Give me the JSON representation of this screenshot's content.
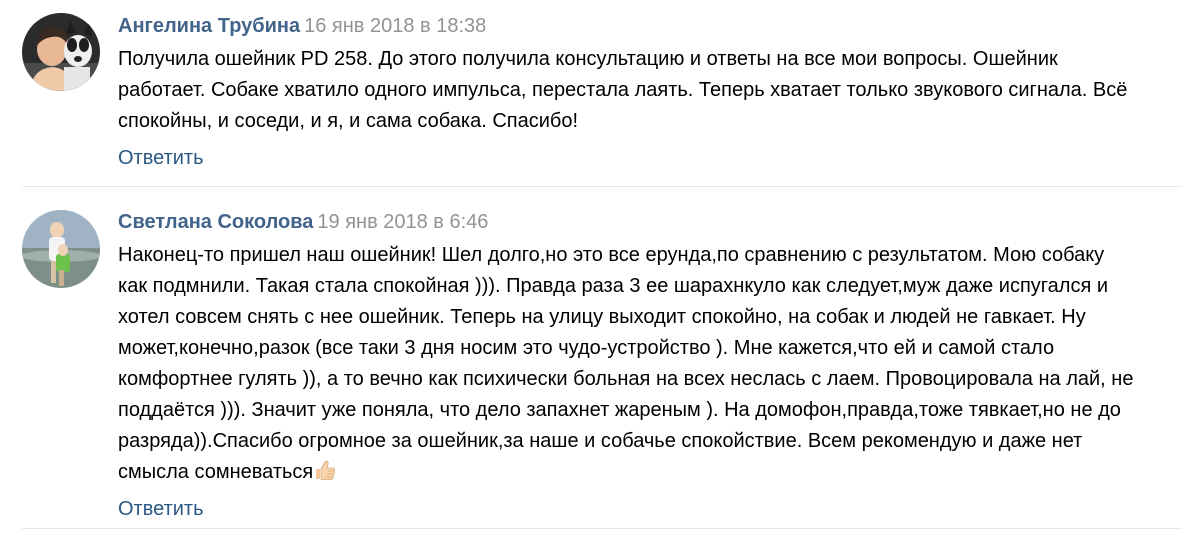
{
  "comments": [
    {
      "author": "Ангелина Трубина",
      "date": "16 янв 2018 в 18:38",
      "text_lines": [
        "Получила ошейник PD 258. До этого получила консультацию и ответы на все мои вопросы. Ошейник",
        "работает. Собаке хватило одного импульса, перестала лаять. Теперь хватает только звукового сигнала. Всё",
        "спокойны, и соседи, и я, и сама собака. Спасибо!"
      ],
      "reply_label": "Ответить"
    },
    {
      "author": "Светлана Соколова",
      "date": "19 янв 2018 в 6:46",
      "text_lines": [
        "Наконец-то пришел наш ошейник! Шел долго,но это все ерунда,по сравнению с результатом. Мою собаку",
        "как подмнили. Такая стала спокойная ))). Правда раза 3 ее шарахнкуло как следует,муж даже испугался и",
        "хотел совсем снять с нее ошейник. Теперь на улицу выходит спокойно, на собак и людей не гавкает. Ну",
        "может,конечно,разок (все таки 3 дня носим это чудо-устройство ). Мне кажется,что ей и самой стало",
        "комфортнее гулять )), а то вечно как психически больная на всех неслась с лаем. Провоцировала на лай, не",
        "поддаётся ))). Значит уже поняла, что дело запахнет жареным ). На домофон,правда,тоже тявкает,но не до",
        "разряда)).Спасибо огромное за ошейник,за наше и собачье спокойствие. Всем рекомендую и даже нет",
        "смысла сомневаться"
      ],
      "emoji": "thumbs-up-icon",
      "reply_label": "Ответить"
    }
  ],
  "colors": {
    "author": "#42648b",
    "date": "#939393",
    "reply": "#2a5885",
    "divider": "#e7e8ec"
  }
}
